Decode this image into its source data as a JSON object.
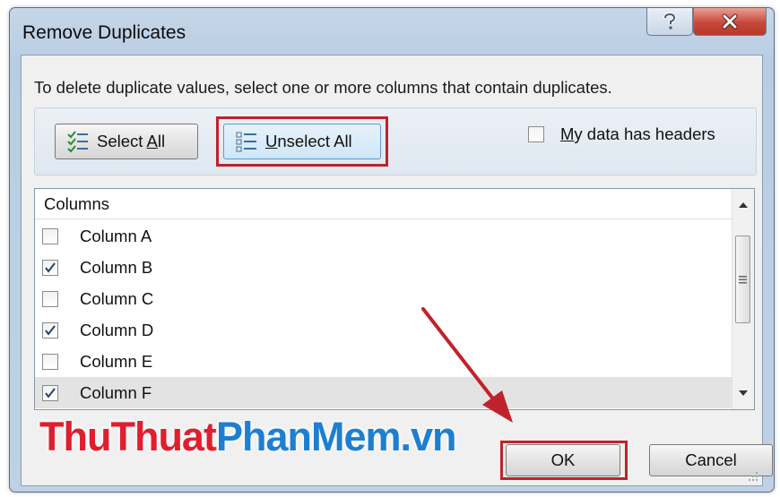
{
  "window": {
    "title": "Remove Duplicates"
  },
  "controls": {
    "help_glyph": "?",
    "close_glyph": "x"
  },
  "instruction": "To delete duplicate values, select one or more columns that contain duplicates.",
  "buttons": {
    "select_all": {
      "pre": "Select ",
      "key": "A",
      "post": "ll",
      "icon": "checklist-icon"
    },
    "unselect_all": {
      "pre": "",
      "key": "U",
      "post": "nselect All",
      "icon": "list-icon"
    },
    "ok": "OK",
    "cancel": "Cancel"
  },
  "headers_checkbox": {
    "key": "M",
    "post": "y data has headers",
    "checked": false
  },
  "list": {
    "header": "Columns",
    "items": [
      {
        "label": "Column A",
        "checked": false
      },
      {
        "label": "Column B",
        "checked": true
      },
      {
        "label": "Column C",
        "checked": false
      },
      {
        "label": "Column D",
        "checked": true
      },
      {
        "label": "Column E",
        "checked": false
      },
      {
        "label": "Column F",
        "checked": true
      }
    ]
  },
  "watermark": {
    "part1": "ThuThuat",
    "part2": "PhanMem.vn"
  },
  "colors": {
    "highlight_frame": "#c0222b",
    "watermark_red": "#e01e2e",
    "watermark_blue": "#1c7fd1"
  }
}
